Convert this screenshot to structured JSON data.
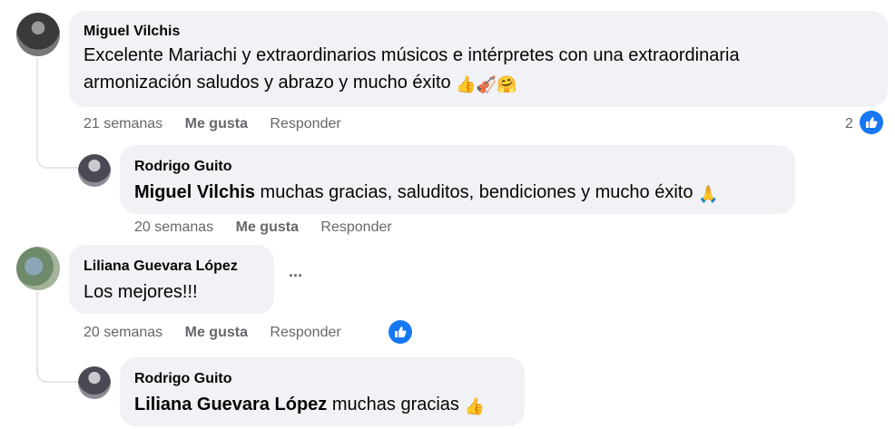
{
  "comments": [
    {
      "author": "Miguel Vilchis",
      "text": "Excelente Mariachi y extraordinarios músicos e intérpretes con una extraordinaria",
      "text_line2": "armonización saludos y abrazo y mucho éxito",
      "emojis": [
        "👍",
        "🎻",
        "🤗"
      ],
      "time": "21 semanas",
      "like_label": "Me gusta",
      "reply_label": "Responder",
      "reaction_count": "2",
      "avatar_colors": [
        "#3a3a3a",
        "#6b6b6b"
      ]
    },
    {
      "author": "Rodrigo Guito",
      "mention": "Miguel Vilchis",
      "text": " muchas gracias, saluditos, bendiciones y mucho éxito",
      "emoji": "🙏",
      "time": "20 semanas",
      "like_label": "Me gusta",
      "reply_label": "Responder"
    },
    {
      "author": "Liliana Guevara López",
      "text": "Los mejores!!!",
      "more_label": "···",
      "time": "20 semanas",
      "like_label": "Me gusta",
      "reply_label": "Responder"
    },
    {
      "author": "Rodrigo Guito",
      "mention": "Liliana Guevara López",
      "text": " muchas gracias",
      "emoji": "👍"
    }
  ],
  "colors": {
    "bubble": "#f0f2f5",
    "meta": "#65676b",
    "like_blue": "#1877f2"
  },
  "icons": [
    "like-thumb-icon"
  ]
}
